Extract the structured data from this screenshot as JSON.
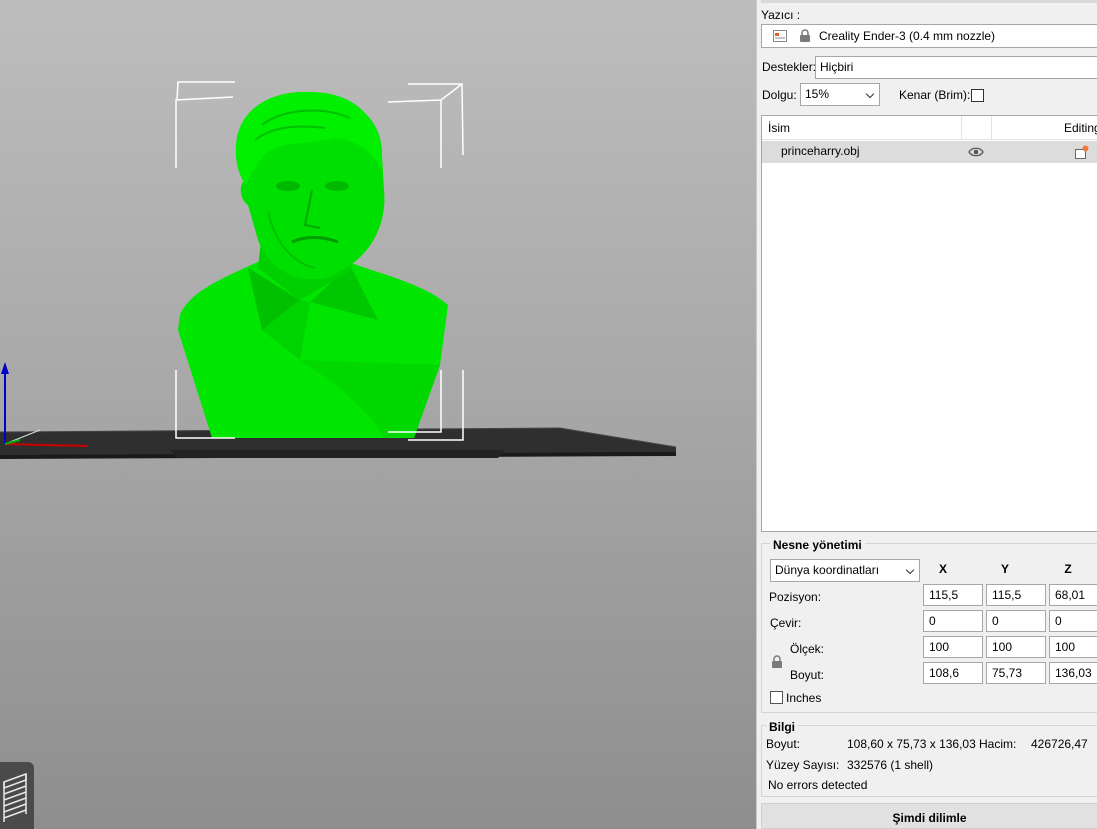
{
  "printer": {
    "label": "Yazıcı :",
    "value": "Creality Ender-3 (0.4 mm nozzle)"
  },
  "supports": {
    "label": "Destekler:",
    "value": "Hiçbiri"
  },
  "infill": {
    "label": "Dolgu:",
    "value": "15%"
  },
  "brim": {
    "label": "Kenar (Brim):",
    "checked": false
  },
  "object_list": {
    "columns": [
      "İsim",
      "",
      "Editing"
    ],
    "items": [
      {
        "name": "princeharry.obj",
        "icons": [
          "eye-icon",
          "edit-settings-icon"
        ]
      }
    ]
  },
  "object_manipulation": {
    "title": "Nesne yönetimi",
    "coordinate_system": "Dünya koordinatları",
    "axes": [
      "X",
      "Y",
      "Z"
    ],
    "rows": {
      "position": {
        "label": "Pozisyon:",
        "x": "115,5",
        "y": "115,5",
        "z": "68,01"
      },
      "rotate": {
        "label": "Çevir:",
        "x": "0",
        "y": "0",
        "z": "0"
      },
      "scale": {
        "label": "Ölçek:",
        "x": "100",
        "y": "100",
        "z": "100"
      },
      "size": {
        "label": "Boyut:",
        "x": "108,6",
        "y": "75,73",
        "z": "136,03"
      }
    },
    "inches_label": "Inches",
    "inches_checked": false
  },
  "info": {
    "title": "Bilgi",
    "size_label": "Boyut:",
    "size_value": "108,60 x 75,73 x 136,03",
    "volume_label": "Hacim:",
    "volume_value": "426726,47",
    "facets_label": "Yüzey Sayısı:",
    "facets_value": "332576 (1 shell)",
    "status": "No errors detected"
  },
  "slice_button": "Şimdi dilimle",
  "colors": {
    "model": "#00ee00",
    "bed": "#2f2f2f",
    "viewport_top": "#bdbdbd",
    "viewport_bottom": "#8e8e8e",
    "axis_z": "#0000cc",
    "axis_x": "#cc0000"
  },
  "icons": {
    "printer_settings": "printer-settings-icon",
    "lock": "lock-icon",
    "layers": "layers-icon"
  }
}
